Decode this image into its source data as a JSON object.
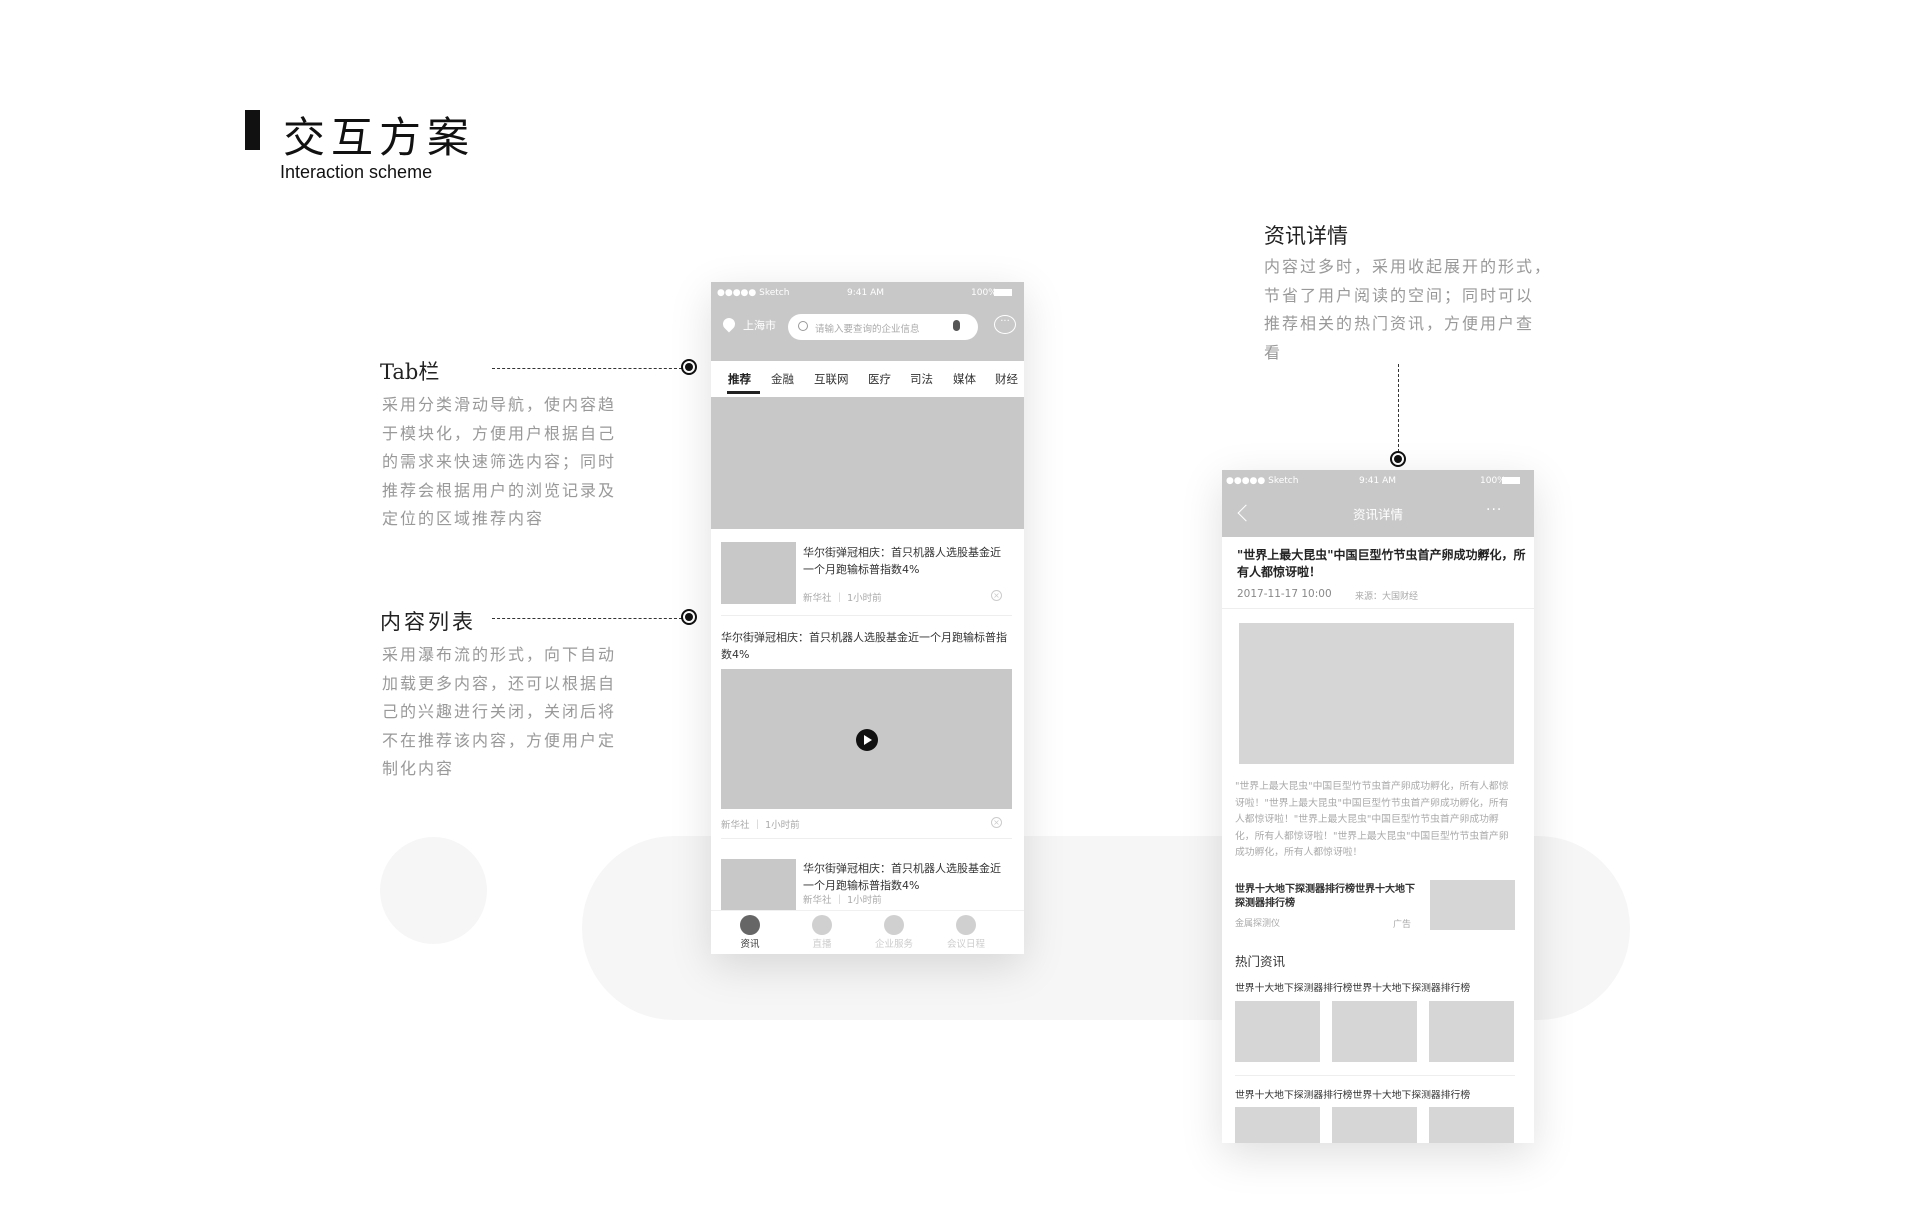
{
  "header": {
    "title": "交互方案",
    "subtitle": "Interaction scheme"
  },
  "annotations": {
    "tab": {
      "title": "Tab栏",
      "lines": [
        "采用分类滑动导航，使内容趋",
        "于模块化，方便用户根据自己",
        "的需求来快速筛选内容；同时",
        "推荐会根据用户的浏览记录及",
        "定位的区域推荐内容"
      ]
    },
    "list": {
      "title": "内容列表",
      "lines": [
        "采用瀑布流的形式，向下自动",
        "加载更多内容，还可以根据自",
        "己的兴趣进行关闭，关闭后将",
        "不在推荐该内容，方便用户定",
        "制化内容"
      ]
    },
    "detail": {
      "title": "资讯详情",
      "lines": [
        "内容过多时，采用收起展开的形式，",
        "节省了用户阅读的空间；同时可以",
        "推荐相关的热门资讯，方便用户查",
        "看"
      ]
    }
  },
  "status": {
    "carrier": "●●●●● Sketch",
    "time": "9:41 AM",
    "battery": "100%"
  },
  "phone1": {
    "city": "上海市",
    "search_placeholder": "请输入要查询的企业信息",
    "tabs": [
      "推荐",
      "金融",
      "互联网",
      "医疗",
      "司法",
      "媒体",
      "财经"
    ],
    "active_tab": 0,
    "items": [
      {
        "title": "华尔街弹冠相庆：首只机器人选股基金近一个月跑输标普指数4%",
        "source": "新华社",
        "time": "1小时前"
      },
      {
        "title": "华尔街弹冠相庆：首只机器人选股基金近一个月跑输标普指数4%",
        "source": "新华社",
        "time": "1小时前"
      },
      {
        "title": "华尔街弹冠相庆：首只机器人选股基金近一个月跑输标普指数4%",
        "source": "新华社",
        "time": "1小时前"
      }
    ],
    "nav": [
      "资讯",
      "直播",
      "企业服务",
      "会议日程"
    ],
    "active_nav": 0
  },
  "phone2": {
    "nav_title": "资讯详情",
    "article_title": "\"世界上最大昆虫\"中国巨型竹节虫首产卵成功孵化，所有人都惊讶啦！",
    "date": "2017-11-17  10:00",
    "source": "来源：大国财经",
    "body": "\"世界上最大昆虫\"中国巨型竹节虫首产卵成功孵化，所有人都惊讶啦！\"世界上最大昆虫\"中国巨型竹节虫首产卵成功孵化，所有人都惊讶啦！\"世界上最大昆虫\"中国巨型竹节虫首产卵成功孵化，所有人都惊讶啦！\"世界上最大昆虫\"中国巨型竹节虫首产卵成功孵化，所有人都惊讶啦！",
    "ad": {
      "title": "世界十大地下探测器排行榜世界十大地下探测器排行榜",
      "sponsor": "金属探测仪",
      "tag": "广告"
    },
    "hot_title": "热门资讯",
    "hot": [
      "世界十大地下探测器排行榜世界十大地下探测器排行榜",
      "世界十大地下探测器排行榜世界十大地下探测器排行榜"
    ]
  }
}
